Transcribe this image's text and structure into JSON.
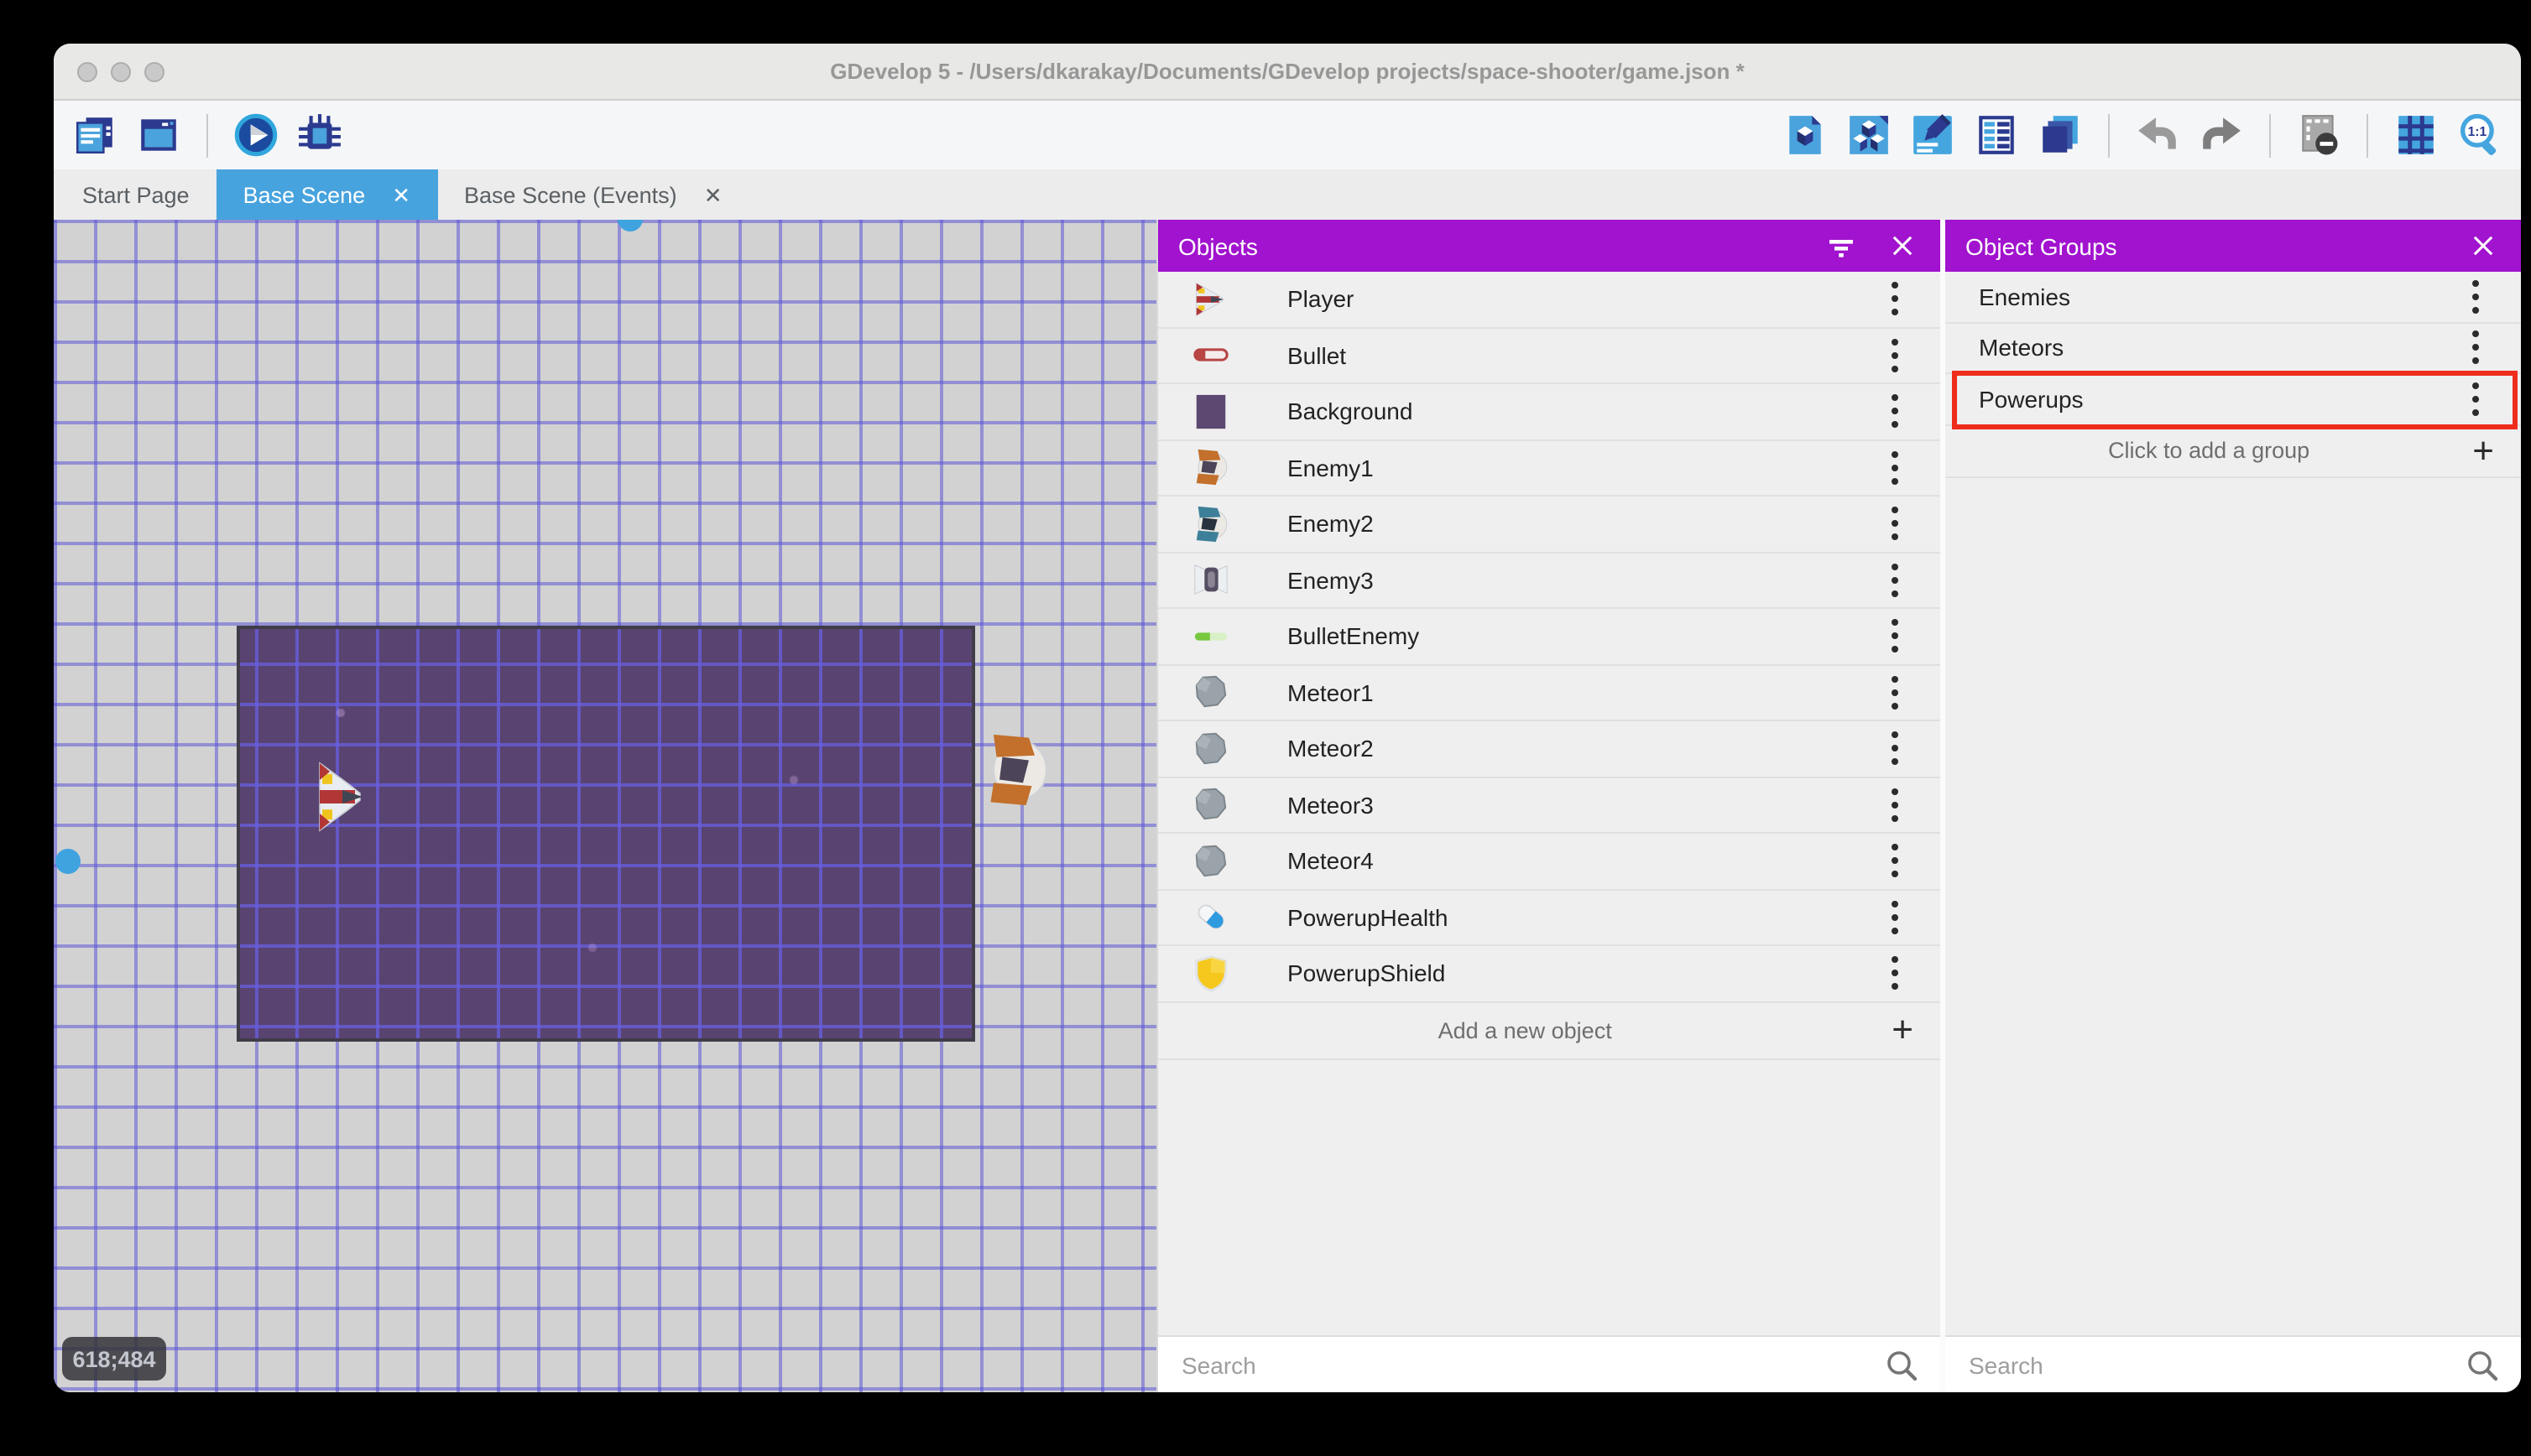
{
  "window": {
    "title": "GDevelop 5 - /Users/dkarakay/Documents/GDevelop projects/space-shooter/game.json *",
    "traffic_lights": [
      "close",
      "minimize",
      "zoom"
    ]
  },
  "toolbar": {
    "left_icons": [
      {
        "icon": "project-manager-icon"
      },
      {
        "icon": "scene-window-icon"
      },
      {
        "icon": "divider"
      },
      {
        "icon": "preview-play-icon"
      },
      {
        "icon": "debug-icon"
      }
    ],
    "right_icons": [
      {
        "icon": "objects-panel-icon"
      },
      {
        "icon": "object-groups-icon"
      },
      {
        "icon": "properties-pencil-icon"
      },
      {
        "icon": "instances-list-icon"
      },
      {
        "icon": "layers-icon"
      },
      {
        "icon": "divider"
      },
      {
        "icon": "undo-icon"
      },
      {
        "icon": "redo-icon"
      },
      {
        "icon": "divider"
      },
      {
        "icon": "mask-icon"
      },
      {
        "icon": "divider"
      },
      {
        "icon": "grid-icon"
      },
      {
        "icon": "zoom-1-1-icon"
      }
    ]
  },
  "tabs": [
    {
      "label": "Start Page",
      "active": false,
      "closable": false
    },
    {
      "label": "Base Scene",
      "active": true,
      "closable": true
    },
    {
      "label": "Base Scene (Events)",
      "active": false,
      "closable": true
    }
  ],
  "canvas": {
    "coordinates_badge": "618;484"
  },
  "objects_panel": {
    "title": "Objects",
    "items": [
      {
        "name": "Player",
        "icon": "player-ship-icon"
      },
      {
        "name": "Bullet",
        "icon": "bullet-icon"
      },
      {
        "name": "Background",
        "icon": "background-icon"
      },
      {
        "name": "Enemy1",
        "icon": "enemy1-ship-icon"
      },
      {
        "name": "Enemy2",
        "icon": "enemy2-ship-icon"
      },
      {
        "name": "Enemy3",
        "icon": "enemy3-ship-icon"
      },
      {
        "name": "BulletEnemy",
        "icon": "bullet-enemy-icon"
      },
      {
        "name": "Meteor1",
        "icon": "meteor-icon"
      },
      {
        "name": "Meteor2",
        "icon": "meteor-icon"
      },
      {
        "name": "Meteor3",
        "icon": "meteor-icon"
      },
      {
        "name": "Meteor4",
        "icon": "meteor-icon"
      },
      {
        "name": "PowerupHealth",
        "icon": "powerup-health-icon"
      },
      {
        "name": "PowerupShield",
        "icon": "powerup-shield-icon"
      }
    ],
    "add_label": "Add a new object",
    "search_placeholder": "Search"
  },
  "groups_panel": {
    "title": "Object Groups",
    "items": [
      {
        "name": "Enemies",
        "highlighted": false
      },
      {
        "name": "Meteors",
        "highlighted": false
      },
      {
        "name": "Powerups",
        "highlighted": true
      }
    ],
    "add_label": "Click to add a group",
    "search_placeholder": "Search"
  },
  "colors": {
    "panel_header_purple": "#A113CE",
    "active_tab_blue": "#47A3DE",
    "highlight_red": "#EE2D1C",
    "scene_background_purple": "#594370",
    "canvas_gray": "#D2D2D2"
  }
}
